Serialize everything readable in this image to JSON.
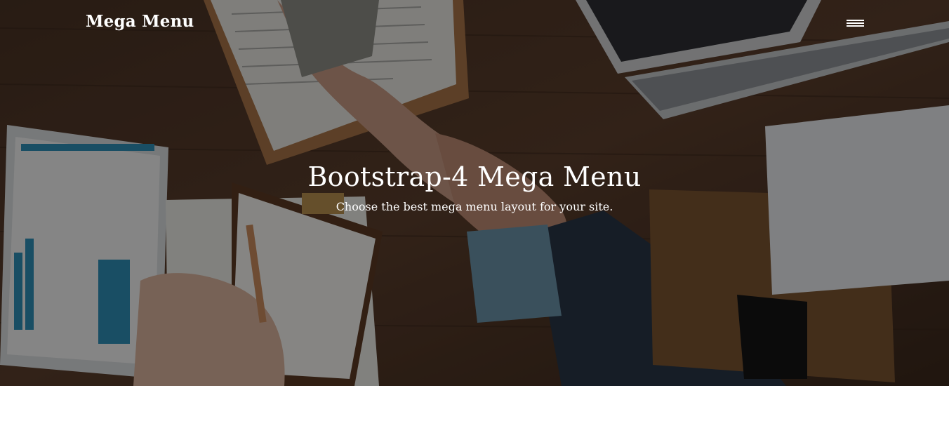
{
  "navbar": {
    "brand": "Mega Menu",
    "menu_icon": "hamburger-menu-icon"
  },
  "hero": {
    "title": "Bootstrap-4 Mega Menu",
    "subtitle": "Choose the best mega menu layout for your site.",
    "background_description_icon": "business-handshake-photo",
    "overlay_color": "#000000"
  },
  "colors": {
    "text": "#ffffff",
    "page_background": "#ffffff"
  }
}
